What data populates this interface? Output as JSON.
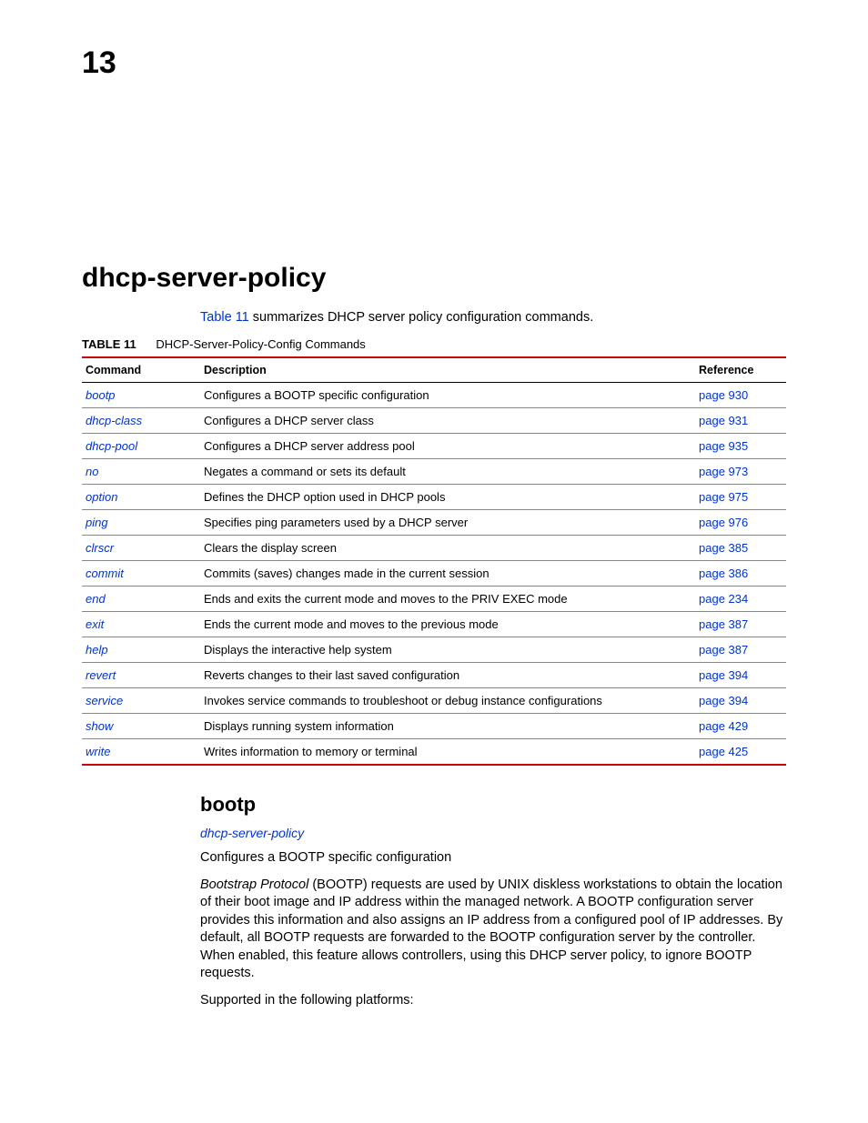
{
  "chapter": "13",
  "title": "dhcp-server-policy",
  "intro_link": "Table 11",
  "intro_rest": " summarizes DHCP server policy configuration commands.",
  "table": {
    "label": "TABLE 11",
    "caption": "DHCP-Server-Policy-Config Commands",
    "headers": {
      "command": "Command",
      "description": "Description",
      "reference": "Reference"
    },
    "rows": [
      {
        "cmd": "bootp",
        "desc": "Configures a BOOTP specific configuration",
        "ref": "page 930"
      },
      {
        "cmd": "dhcp-class",
        "desc": "Configures a DHCP server class",
        "ref": "page 931"
      },
      {
        "cmd": "dhcp-pool",
        "desc": "Configures a DHCP server address pool",
        "ref": "page 935"
      },
      {
        "cmd": "no",
        "desc": "Negates a command or sets its default",
        "ref": "page 973"
      },
      {
        "cmd": "option",
        "desc": "Defines the DHCP option used in DHCP pools",
        "ref": "page 975"
      },
      {
        "cmd": "ping",
        "desc": "Specifies ping parameters used by a DHCP server",
        "ref": "page 976"
      },
      {
        "cmd": "clrscr",
        "desc": "Clears the display screen",
        "ref": "page 385"
      },
      {
        "cmd": "commit",
        "desc": "Commits (saves) changes made in the current session",
        "ref": "page 386"
      },
      {
        "cmd": "end",
        "desc": "Ends and exits the current mode and moves to the PRIV EXEC mode",
        "ref": "page 234"
      },
      {
        "cmd": "exit",
        "desc": "Ends the current mode and moves to the previous mode",
        "ref": "page 387"
      },
      {
        "cmd": "help",
        "desc": "Displays the interactive help system",
        "ref": "page 387"
      },
      {
        "cmd": "revert",
        "desc": "Reverts changes to their last saved configuration",
        "ref": "page 394"
      },
      {
        "cmd": "service",
        "desc": "Invokes service commands to troubleshoot or debug              instance configurations",
        "ref": "page 394"
      },
      {
        "cmd": "show",
        "desc": "Displays running system information",
        "ref": "page 429"
      },
      {
        "cmd": "write",
        "desc": "Writes information to memory or terminal",
        "ref": "page 425"
      }
    ]
  },
  "section": {
    "heading": "bootp",
    "parent_link": "dhcp-server-policy",
    "p1": "Configures a BOOTP specific configuration",
    "p2_ital": "Bootstrap Protocol",
    "p2_rest": " (BOOTP) requests are used by UNIX diskless workstations to obtain the location of their boot image and IP address within the managed network. A BOOTP configuration server provides this information and also assigns an IP address from a configured pool of IP addresses. By default, all BOOTP requests are forwarded to the BOOTP configuration server by the controller. When enabled, this feature allows controllers, using this DHCP server policy, to ignore BOOTP requests.",
    "p3": "Supported in the following platforms:"
  }
}
